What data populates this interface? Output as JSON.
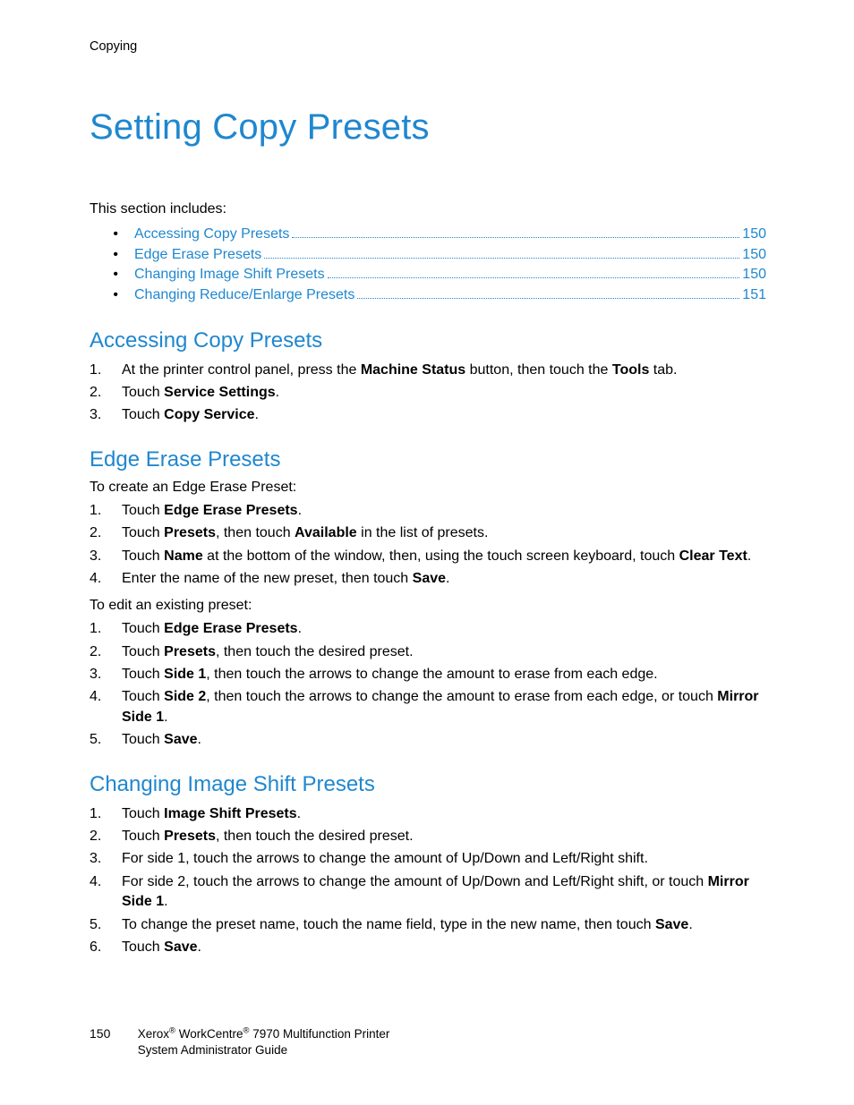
{
  "runningHeader": "Copying",
  "title": "Setting Copy Presets",
  "sectionIncludes": "This section includes:",
  "toc": [
    {
      "label": "Accessing Copy Presets",
      "page": "150"
    },
    {
      "label": "Edge Erase Presets",
      "page": "150"
    },
    {
      "label": "Changing Image Shift Presets",
      "page": "150"
    },
    {
      "label": "Changing Reduce/Enlarge Presets",
      "page": "151"
    }
  ],
  "sections": {
    "accessing": {
      "heading": "Accessing Copy Presets",
      "steps": [
        [
          {
            "t": "At the printer control panel, press the "
          },
          {
            "t": "Machine Status",
            "b": true
          },
          {
            "t": " button, then touch the "
          },
          {
            "t": "Tools",
            "b": true
          },
          {
            "t": " tab."
          }
        ],
        [
          {
            "t": "Touch "
          },
          {
            "t": "Service Settings",
            "b": true
          },
          {
            "t": "."
          }
        ],
        [
          {
            "t": "Touch "
          },
          {
            "t": "Copy Service",
            "b": true
          },
          {
            "t": "."
          }
        ]
      ]
    },
    "edgeErase": {
      "heading": "Edge Erase Presets",
      "lead1": "To create an Edge Erase Preset:",
      "steps1": [
        [
          {
            "t": "Touch "
          },
          {
            "t": "Edge Erase Presets",
            "b": true
          },
          {
            "t": "."
          }
        ],
        [
          {
            "t": "Touch "
          },
          {
            "t": "Presets",
            "b": true
          },
          {
            "t": ", then touch "
          },
          {
            "t": "Available",
            "b": true
          },
          {
            "t": " in the list of presets."
          }
        ],
        [
          {
            "t": "Touch "
          },
          {
            "t": "Name",
            "b": true
          },
          {
            "t": " at the bottom of the window, then, using the touch screen keyboard, touch "
          },
          {
            "t": "Clear Text",
            "b": true
          },
          {
            "t": "."
          }
        ],
        [
          {
            "t": "Enter the name of the new preset, then touch "
          },
          {
            "t": "Save",
            "b": true
          },
          {
            "t": "."
          }
        ]
      ],
      "lead2": "To edit an existing preset:",
      "steps2": [
        [
          {
            "t": "Touch "
          },
          {
            "t": "Edge Erase Presets",
            "b": true
          },
          {
            "t": "."
          }
        ],
        [
          {
            "t": "Touch "
          },
          {
            "t": "Presets",
            "b": true
          },
          {
            "t": ", then touch the desired preset."
          }
        ],
        [
          {
            "t": "Touch "
          },
          {
            "t": "Side 1",
            "b": true
          },
          {
            "t": ", then touch the arrows to change the amount to erase from each edge."
          }
        ],
        [
          {
            "t": "Touch "
          },
          {
            "t": "Side 2",
            "b": true
          },
          {
            "t": ", then touch the arrows to change the amount to erase from each edge, or touch "
          },
          {
            "t": "Mirror Side 1",
            "b": true
          },
          {
            "t": "."
          }
        ],
        [
          {
            "t": "Touch "
          },
          {
            "t": "Save",
            "b": true
          },
          {
            "t": "."
          }
        ]
      ]
    },
    "imageShift": {
      "heading": "Changing Image Shift Presets",
      "steps": [
        [
          {
            "t": "Touch "
          },
          {
            "t": "Image Shift Presets",
            "b": true
          },
          {
            "t": "."
          }
        ],
        [
          {
            "t": "Touch "
          },
          {
            "t": "Presets",
            "b": true
          },
          {
            "t": ", then touch the desired preset."
          }
        ],
        [
          {
            "t": "For side 1, touch the arrows to change the amount of Up/Down and Left/Right shift."
          }
        ],
        [
          {
            "t": "For side 2, touch the arrows to change the amount of Up/Down and Left/Right shift, or touch "
          },
          {
            "t": "Mirror Side 1",
            "b": true
          },
          {
            "t": "."
          }
        ],
        [
          {
            "t": "To change the preset name, touch the name field, type in the new name, then touch "
          },
          {
            "t": "Save",
            "b": true
          },
          {
            "t": "."
          }
        ],
        [
          {
            "t": "Touch "
          },
          {
            "t": "Save",
            "b": true
          },
          {
            "t": "."
          }
        ]
      ]
    }
  },
  "footer": {
    "pageNumber": "150",
    "line1a": "Xerox",
    "line1b": " WorkCentre",
    "line1c": " 7970 Multifunction Printer",
    "line2": "System Administrator Guide",
    "reg": "®"
  }
}
